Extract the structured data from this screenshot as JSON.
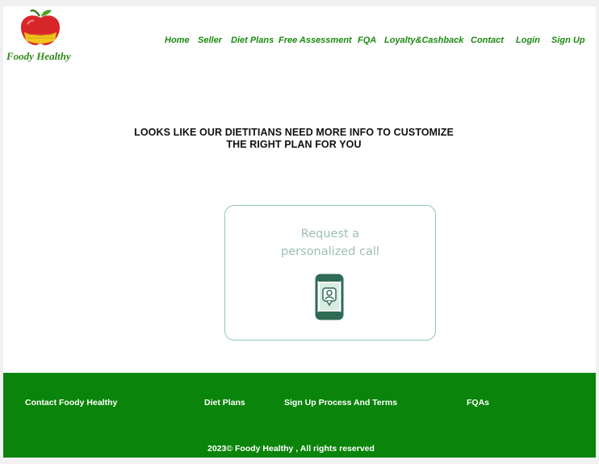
{
  "brand": {
    "name": "Foody Healthy"
  },
  "nav": {
    "items": [
      {
        "label": "Home"
      },
      {
        "label": "Seller"
      },
      {
        "label": "Diet Plans"
      },
      {
        "label": "Free Assessment"
      },
      {
        "label": "FQA"
      },
      {
        "label": "Loyalty&Cashback"
      },
      {
        "label": "Contact"
      },
      {
        "label": "Login"
      },
      {
        "label": "Sign Up"
      }
    ]
  },
  "main": {
    "headline_line1": "LOOKS LIKE OUR DIETITIANS NEED MORE INFO TO CUSTOMIZE",
    "headline_line2": "THE RIGHT PLAN FOR YOU",
    "call_card": {
      "line1": "Request a",
      "line2": "personalized call",
      "icon": "phone-call-icon"
    }
  },
  "footer": {
    "links": [
      {
        "label": "Contact Foody Healthy"
      },
      {
        "label": "Diet Plans"
      },
      {
        "label": "Sign Up Process And Terms"
      },
      {
        "label": "FQAs"
      }
    ],
    "copyright": "2023© Foody Healthy , All rights reserved"
  },
  "colors": {
    "accent_green": "#1b8a10",
    "footer_green": "#0a840a",
    "card_border": "#8fc9ae",
    "card_text": "#9cbfae",
    "phone_icon": "#2f6b55"
  }
}
